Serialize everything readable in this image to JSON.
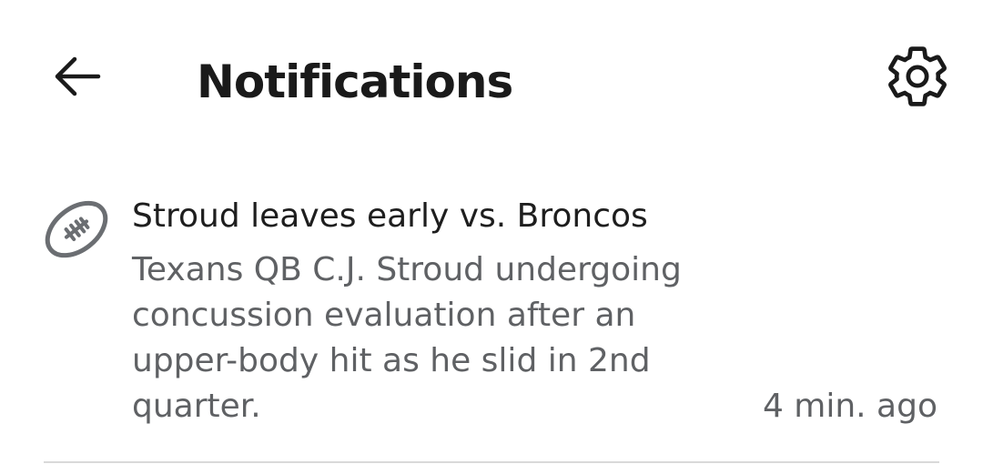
{
  "header": {
    "title": "Notifications",
    "back_icon": "arrow-left-icon",
    "settings_icon": "gear-icon"
  },
  "notifications": [
    {
      "icon": "football-icon",
      "title": "Stroud leaves early vs. Broncos",
      "body": "Texans QB C.J. Stroud undergoing concussion evaluation after an upper-body hit as he slid in 2nd quarter.",
      "time": "4 min. ago"
    }
  ],
  "colors": {
    "title_text": "#1a1a1a",
    "secondary_text": "#5f6164",
    "icon": "#1a1a1a",
    "sport_icon": "#6b6e72",
    "divider": "#d9d9d9"
  }
}
